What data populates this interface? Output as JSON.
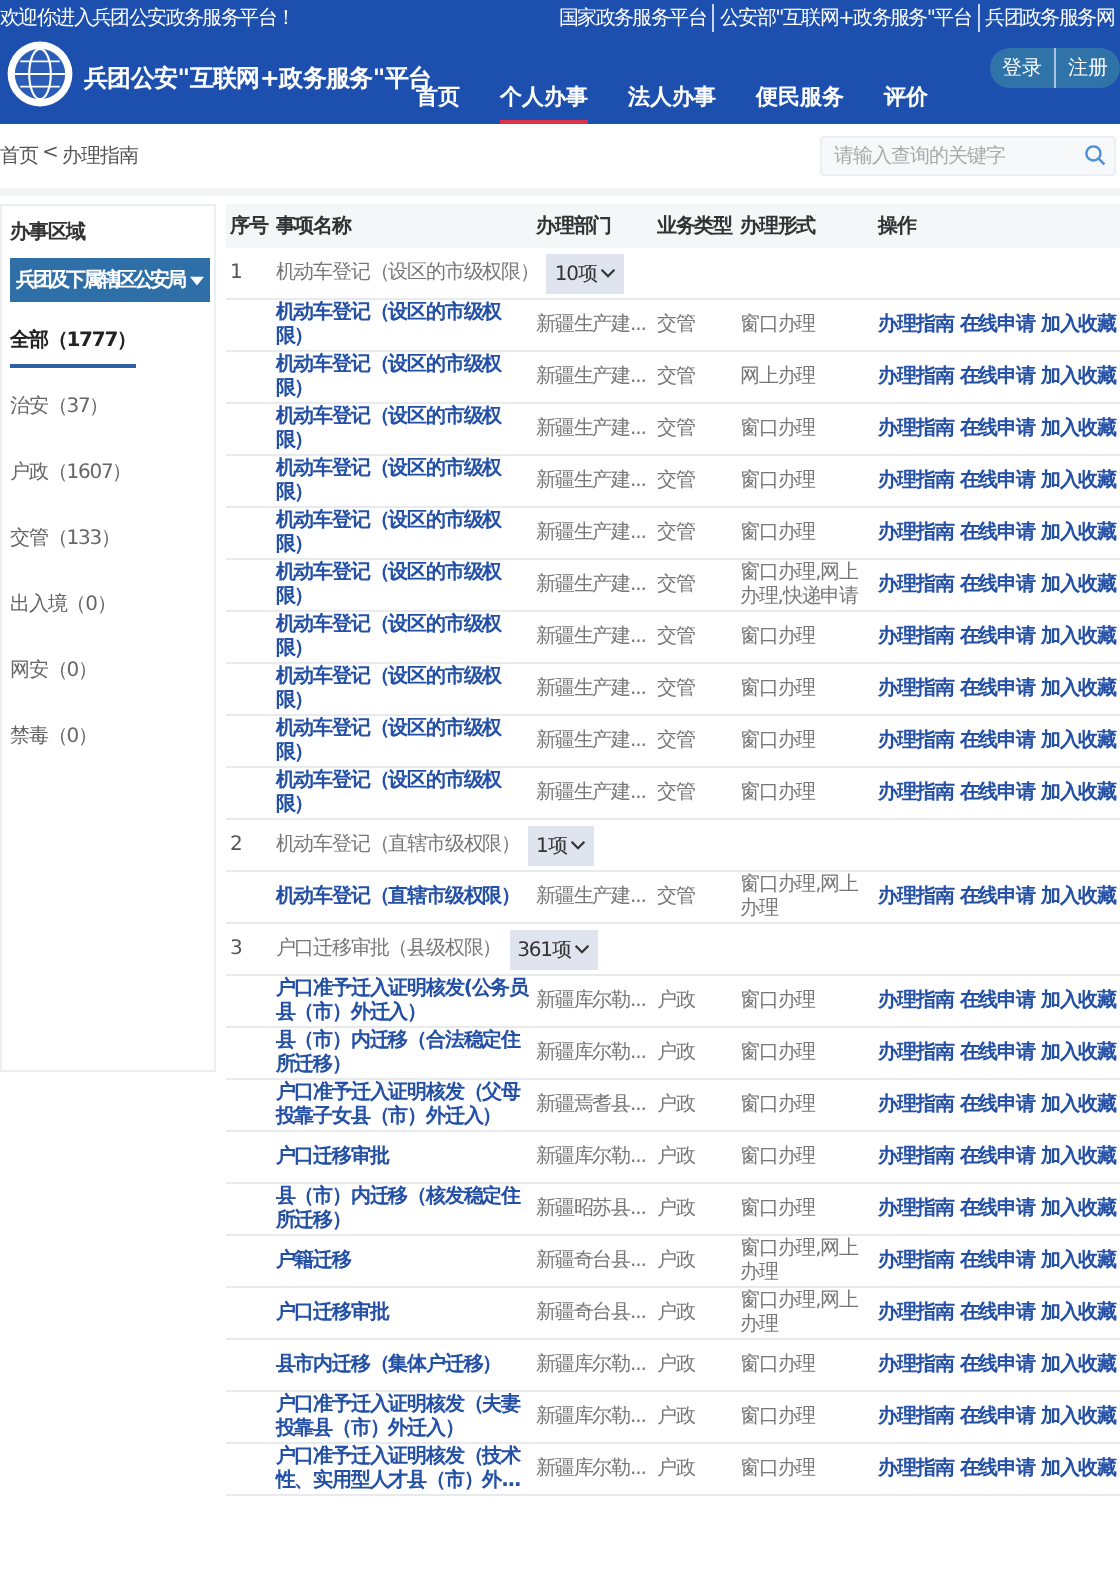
{
  "top_bar": {
    "welcome": "欢迎你进入兵团公安政务服务平台！",
    "links": [
      "国家政务服务平台",
      "公安部\"互联网+政务服务\"平台",
      "兵团政务服务网"
    ]
  },
  "header": {
    "title": "兵团公安\"互联网+政务服务\"平台",
    "auth_buttons": [
      "登录",
      "注册"
    ],
    "nav": [
      {
        "label": "首页",
        "selected": false
      },
      {
        "label": "个人办事",
        "selected": true
      },
      {
        "label": "法人办事",
        "selected": false
      },
      {
        "label": "便民服务",
        "selected": false
      },
      {
        "label": "评价",
        "selected": false
      }
    ]
  },
  "breadcrumb": {
    "items": [
      "首页",
      "<",
      "办理指南"
    ]
  },
  "search": {
    "placeholder": "请输入查询的关键字"
  },
  "sidebar": {
    "title": "办事区域",
    "region_button": "兵团及下属辖区公安局",
    "items": [
      {
        "label": "全部（1777）",
        "selected": true
      },
      {
        "label": "治安（37）",
        "selected": false
      },
      {
        "label": "户政（1607）",
        "selected": false
      },
      {
        "label": "交管（133）",
        "selected": false
      },
      {
        "label": "出入境（0）",
        "selected": false
      },
      {
        "label": "网安（0）",
        "selected": false
      },
      {
        "label": "禁毒（0）",
        "selected": false
      }
    ]
  },
  "table": {
    "columns": [
      "序号",
      "事项名称",
      "办理部门",
      "业务类型",
      "办理形式",
      "操作"
    ],
    "groups": [
      {
        "index": "1",
        "name": "机动车登记（设区的市级权限）",
        "count": "10项",
        "expanded": true,
        "items": [
          {
            "name": "机动车登记（设区的市级权限）",
            "department": "新疆生产建...",
            "type": "交管",
            "form": "窗口办理",
            "actions": [
              "办理指南",
              "在线申请",
              "加入收藏"
            ]
          },
          {
            "name": "机动车登记（设区的市级权限）",
            "department": "新疆生产建...",
            "type": "交管",
            "form": "网上办理",
            "actions": [
              "办理指南",
              "在线申请",
              "加入收藏"
            ]
          },
          {
            "name": "机动车登记（设区的市级权限）",
            "department": "新疆生产建...",
            "type": "交管",
            "form": "窗口办理",
            "actions": [
              "办理指南",
              "在线申请",
              "加入收藏"
            ]
          },
          {
            "name": "机动车登记（设区的市级权限）",
            "department": "新疆生产建...",
            "type": "交管",
            "form": "窗口办理",
            "actions": [
              "办理指南",
              "在线申请",
              "加入收藏"
            ]
          },
          {
            "name": "机动车登记（设区的市级权限）",
            "department": "新疆生产建...",
            "type": "交管",
            "form": "窗口办理",
            "actions": [
              "办理指南",
              "在线申请",
              "加入收藏"
            ]
          },
          {
            "name": "机动车登记（设区的市级权限）",
            "department": "新疆生产建...",
            "type": "交管",
            "form": "窗口办理,网上办理,快递申请",
            "actions": [
              "办理指南",
              "在线申请",
              "加入收藏"
            ]
          },
          {
            "name": "机动车登记（设区的市级权限）",
            "department": "新疆生产建...",
            "type": "交管",
            "form": "窗口办理",
            "actions": [
              "办理指南",
              "在线申请",
              "加入收藏"
            ]
          },
          {
            "name": "机动车登记（设区的市级权限）",
            "department": "新疆生产建...",
            "type": "交管",
            "form": "窗口办理",
            "actions": [
              "办理指南",
              "在线申请",
              "加入收藏"
            ]
          },
          {
            "name": "机动车登记（设区的市级权限）",
            "department": "新疆生产建...",
            "type": "交管",
            "form": "窗口办理",
            "actions": [
              "办理指南",
              "在线申请",
              "加入收藏"
            ]
          },
          {
            "name": "机动车登记（设区的市级权限）",
            "department": "新疆生产建...",
            "type": "交管",
            "form": "窗口办理",
            "actions": [
              "办理指南",
              "在线申请",
              "加入收藏"
            ]
          }
        ]
      },
      {
        "index": "2",
        "name": "机动车登记（直辖市级权限）",
        "count": "1项",
        "expanded": true,
        "items": [
          {
            "name": "机动车登记（直辖市级权限）",
            "department": "新疆生产建...",
            "type": "交管",
            "form": "窗口办理,网上办理",
            "actions": [
              "办理指南",
              "在线申请",
              "加入收藏"
            ]
          }
        ]
      },
      {
        "index": "3",
        "name": "户口迁移审批（县级权限）",
        "count": "361项",
        "expanded": true,
        "items": [
          {
            "name": "户口准予迁入证明核发(公务员县（市）外迁入）",
            "department": "新疆库尔勒...",
            "type": "户政",
            "form": "窗口办理",
            "actions": [
              "办理指南",
              "在线申请",
              "加入收藏"
            ]
          },
          {
            "name": "县（市）内迁移（合法稳定住所迁移）",
            "department": "新疆库尔勒...",
            "type": "户政",
            "form": "窗口办理",
            "actions": [
              "办理指南",
              "在线申请",
              "加入收藏"
            ]
          },
          {
            "name": "户口准予迁入证明核发（父母投靠子女县（市）外迁入）",
            "department": "新疆焉耆县...",
            "type": "户政",
            "form": "窗口办理",
            "actions": [
              "办理指南",
              "在线申请",
              "加入收藏"
            ]
          },
          {
            "name": "户口迁移审批",
            "department": "新疆库尔勒...",
            "type": "户政",
            "form": "窗口办理",
            "actions": [
              "办理指南",
              "在线申请",
              "加入收藏"
            ]
          },
          {
            "name": "县（市）内迁移（核发稳定住所迁移）",
            "department": "新疆昭苏县...",
            "type": "户政",
            "form": "窗口办理",
            "actions": [
              "办理指南",
              "在线申请",
              "加入收藏"
            ]
          },
          {
            "name": "户籍迁移",
            "department": "新疆奇台县...",
            "type": "户政",
            "form": "窗口办理,网上办理",
            "actions": [
              "办理指南",
              "在线申请",
              "加入收藏"
            ]
          },
          {
            "name": "户口迁移审批",
            "department": "新疆奇台县...",
            "type": "户政",
            "form": "窗口办理,网上办理",
            "actions": [
              "办理指南",
              "在线申请",
              "加入收藏"
            ]
          },
          {
            "name": "县市内迁移（集体户迁移）",
            "department": "新疆库尔勒...",
            "type": "户政",
            "form": "窗口办理",
            "actions": [
              "办理指南",
              "在线申请",
              "加入收藏"
            ]
          },
          {
            "name": "户口准予迁入证明核发（夫妻投靠县（市）外迁入）",
            "department": "新疆库尔勒...",
            "type": "户政",
            "form": "窗口办理",
            "actions": [
              "办理指南",
              "在线申请",
              "加入收藏"
            ]
          },
          {
            "name": "户口准予迁入证明核发（技术性、实用型人才县（市）外...",
            "department": "新疆库尔勒...",
            "type": "户政",
            "form": "窗口办理",
            "actions": [
              "办理指南",
              "在线申请",
              "加入收藏"
            ]
          }
        ]
      }
    ]
  }
}
